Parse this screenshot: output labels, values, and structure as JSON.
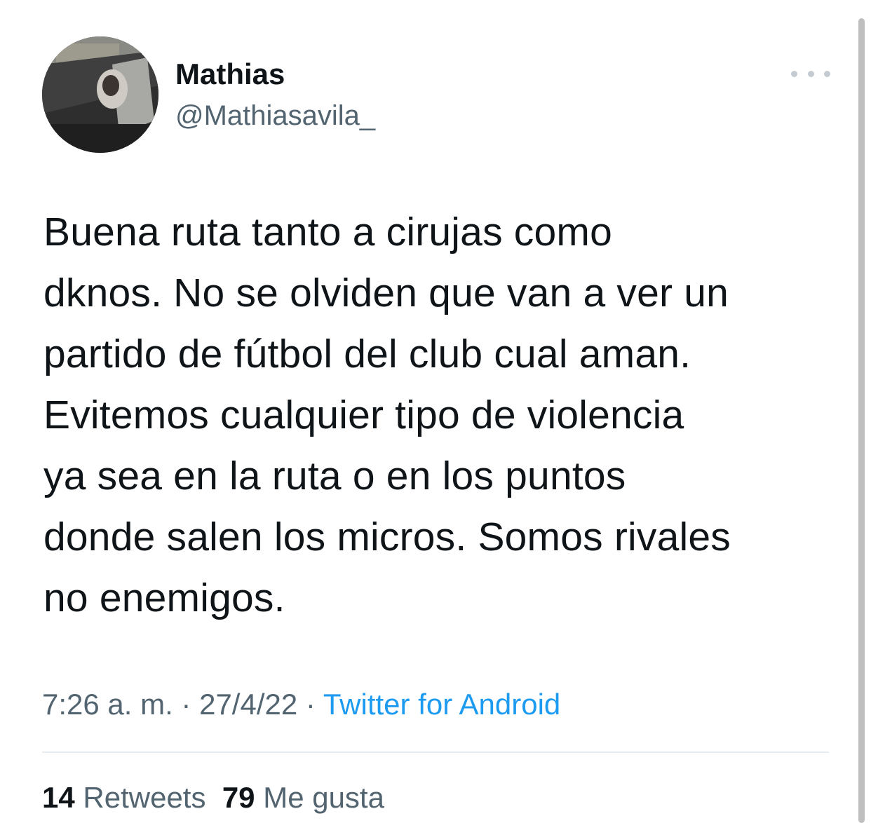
{
  "user": {
    "display_name": "Mathias",
    "handle": "@Mathiasavila_",
    "avatar_icon": "profile-photo"
  },
  "tweet": {
    "lines": [
      "Buena ruta tanto a cirujas como",
      "dknos. No se olviden que van a ver un",
      "partido de fútbol del club cual aman.",
      "Evitemos cualquier tipo de violencia",
      "ya sea en la ruta o en los puntos",
      "donde salen los micros. Somos rivales",
      "no enemigos."
    ],
    "time": "7:26 a. m.",
    "separator": " · ",
    "date": "27/4/22",
    "source": "Twitter for Android"
  },
  "stats": {
    "retweets_count": "14",
    "retweets_label": "Retweets",
    "likes_count": "79",
    "likes_label": "Me gusta"
  },
  "icons": {
    "more": "more-options-icon"
  },
  "colors": {
    "text": "#0f1419",
    "secondary": "#536471",
    "link": "#1d9bf0",
    "divider": "#e6ecf0"
  }
}
